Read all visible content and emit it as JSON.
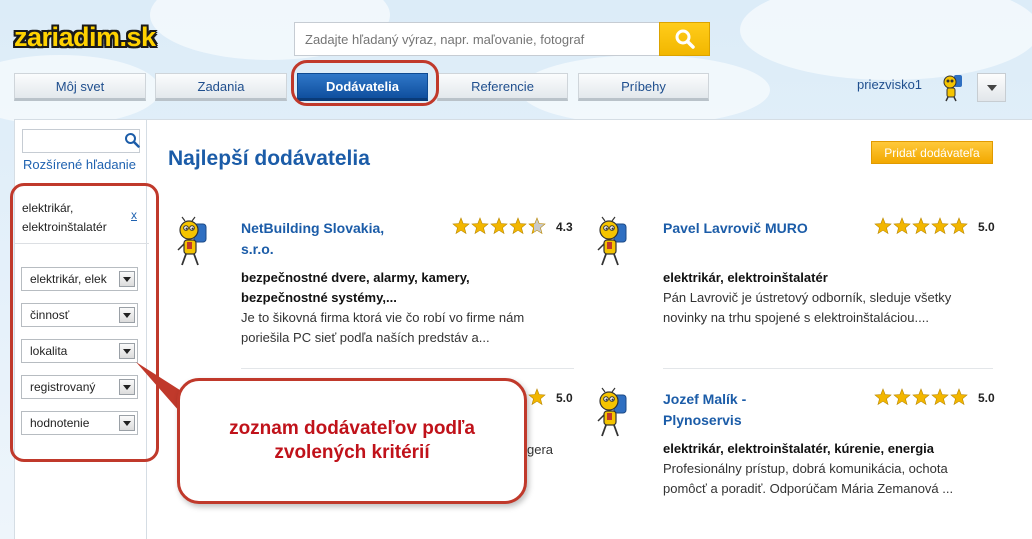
{
  "header": {
    "logo": "zariadim.sk",
    "search_placeholder": "Zadajte hľadaný výraz, napr. maľovanie, fotograf"
  },
  "nav": {
    "tabs": [
      "Môj svet",
      "Zadania",
      "Dodávatelia",
      "Referencie",
      "Príbehy"
    ],
    "active": "Dodávatelia"
  },
  "user": {
    "name": "priezvisko1"
  },
  "sidebar": {
    "advanced_search": "Rozšírené hľadanie",
    "chip": {
      "label": "elektrikár, elektroinštalatér",
      "remove": "x"
    },
    "filters": [
      "elektrikár, elek",
      "činnosť",
      "lokalita",
      "registrovaný",
      "hodnotenie"
    ]
  },
  "main": {
    "heading": "Najlepší dodávatelia",
    "add_button": "Pridať dodávateľa",
    "cards": [
      {
        "name": "NetBuilding Slovakia, s.r.o.",
        "rating": "4.3",
        "stars": 4.3,
        "category": "bezpečnostné dvere, alarmy, kamery, bezpečnostné systémy,...",
        "description": "Je to šikovná firma ktorá vie čo robí vo firme nám poriešila PC sieť podľa naších predstáv a..."
      },
      {
        "name": "Pavel Lavrovič MURO",
        "rating": "5.0",
        "stars": 5,
        "category": "elektrikár, elektroinštalatér",
        "description": "Pán Lavrovič je ústretový odborník, sleduje všetky novinky na trhu spojené s elektroinštaláciou...."
      },
      {
        "name": "",
        "rating": "5.0",
        "stars": 5,
        "category": "",
        "description": "gera"
      },
      {
        "name": "Jozef Malík - Plynoservis",
        "rating": "5.0",
        "stars": 5,
        "category": "elektrikár, elektroinštalatér, kúrenie, energia",
        "description": "Profesionálny prístup, dobrá komunikácia, ochota pomôcť a poradiť. Odporúčam Mária Zemanová ..."
      }
    ]
  },
  "annotation": {
    "callout": "zoznam dodávateľov podľa zvolených kritérií"
  },
  "colors": {
    "brand_blue": "#1b5ca8",
    "accent_yellow": "#f5b800",
    "annotation_red": "#c0392b"
  },
  "icons": [
    "search-icon",
    "chevron-down-icon",
    "star-icon",
    "user-avatar-icon"
  ]
}
